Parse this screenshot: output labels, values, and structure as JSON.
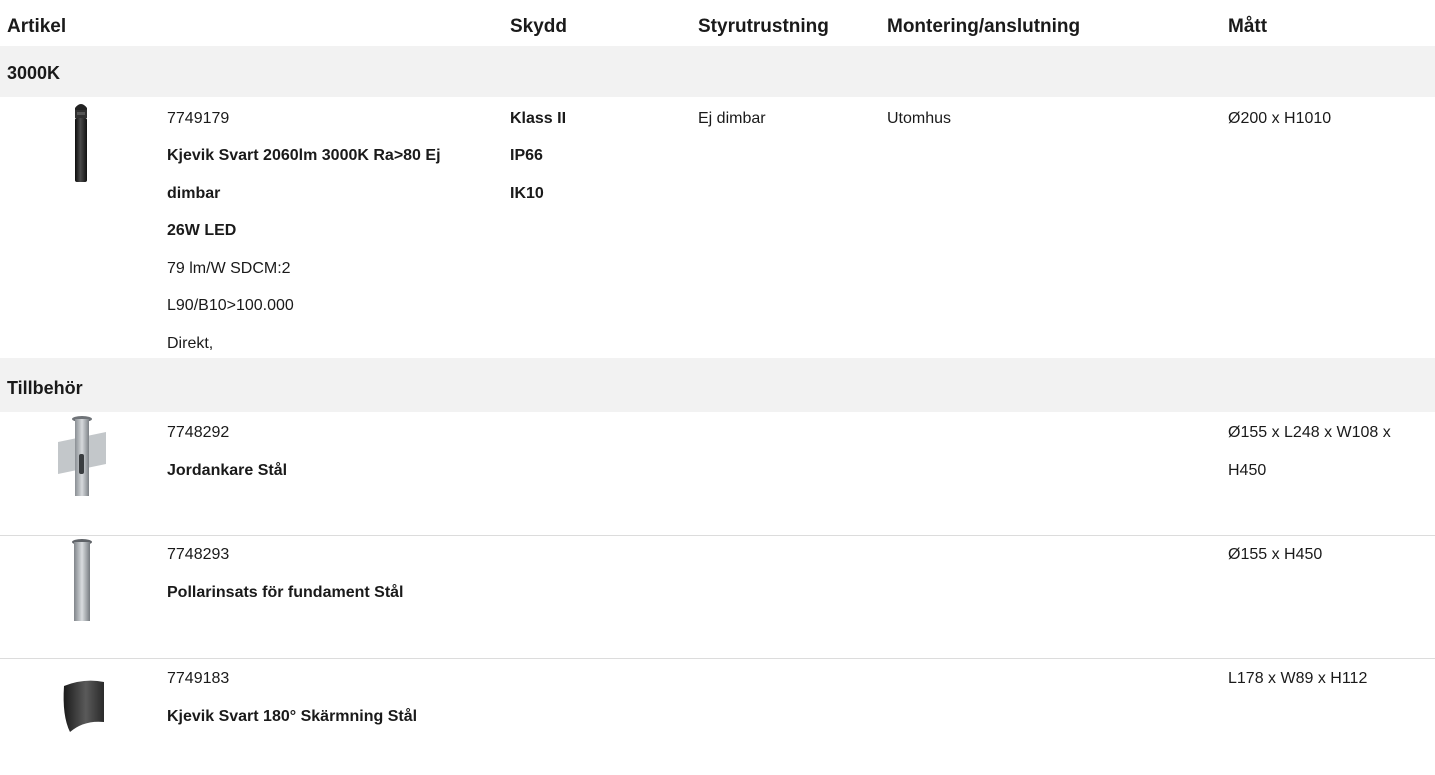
{
  "header": {
    "artikel": "Artikel",
    "skydd": "Skydd",
    "styrutrustning": "Styrutrustning",
    "montering": "Montering/anslutning",
    "matt": "Mått"
  },
  "sections": {
    "s3000k": "3000K",
    "tillbehor": "Tillbehör"
  },
  "product": {
    "number": "7749179",
    "name_line1": "Kjevik Svart 2060lm 3000K Ra>80 Ej",
    "name_line2": "dimbar",
    "power": "26W LED",
    "efficacy": "79 lm/W SDCM:2",
    "lifetime": "L90/B10>100.000",
    "distribution": "Direkt,",
    "skydd": [
      "Klass II",
      "IP66",
      "IK10"
    ],
    "styrutrustning": "Ej dimbar",
    "montering": "Utomhus",
    "matt": "Ø200 x H1010",
    "icon": "bollard-light-icon"
  },
  "accessories": [
    {
      "number": "7748292",
      "name": "Jordankare Stål",
      "matt_line1": "Ø155 x L248 x W108 x",
      "matt_line2": "H450",
      "icon": "ground-anchor-icon"
    },
    {
      "number": "7748293",
      "name": "Pollarinsats för fundament Stål",
      "matt_line1": "Ø155 x H450",
      "icon": "bollard-insert-icon"
    },
    {
      "number": "7749183",
      "name": "Kjevik Svart 180° Skärmning Stål",
      "matt_line1": "L178 x W89 x H112",
      "icon": "shield-icon"
    }
  ],
  "colors": {
    "band": "#f2f2f2",
    "separator": "#dcdcdc",
    "text": "#1a1a1a"
  }
}
